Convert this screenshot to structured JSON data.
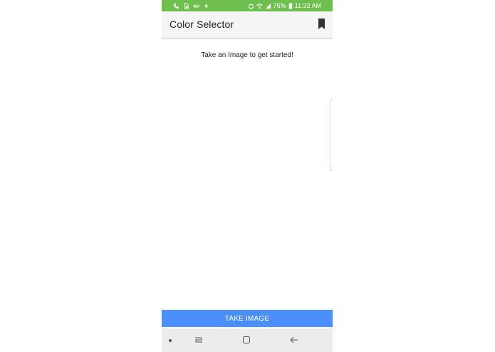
{
  "status_bar": {
    "battery_percent": "76%",
    "time": "11:32 AM",
    "left_icons": [
      "phone-icon",
      "sim-icon",
      "voicemail-icon",
      "flash-icon"
    ],
    "right_icons": [
      "alarm-icon",
      "wifi-icon",
      "signal-icon",
      "battery-icon"
    ]
  },
  "toolbar": {
    "title": "Color Selector",
    "bookmark_icon": "bookmark-icon"
  },
  "content": {
    "hint": "Take an Image to get started!"
  },
  "actions": {
    "take_image_label": "TAKE IMAGE"
  },
  "nav_bar": {
    "icons": [
      "dot-icon",
      "recent-apps-icon",
      "home-icon",
      "back-icon"
    ]
  },
  "colors": {
    "status_bar": "#6fbf4f",
    "accent_button": "#4a8ffc",
    "toolbar_bg": "#f5f5f5",
    "nav_bg": "#ececec"
  }
}
